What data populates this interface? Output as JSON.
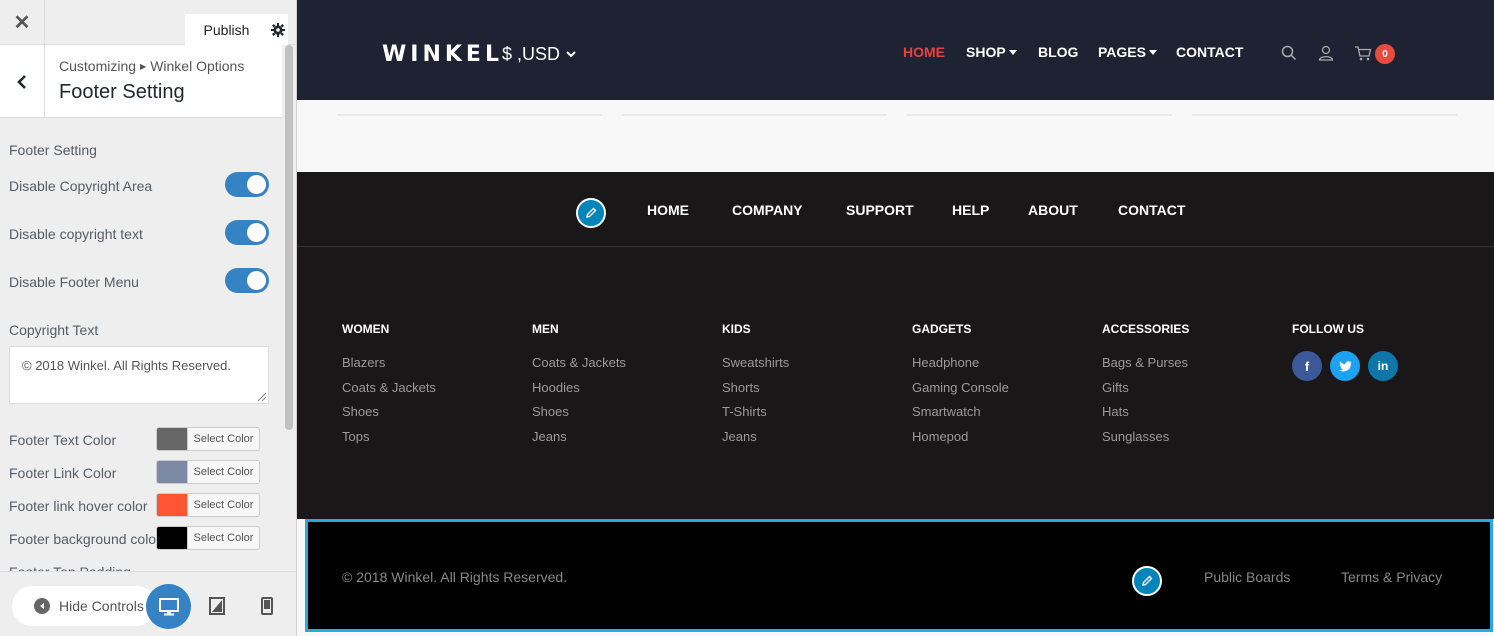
{
  "customizer": {
    "close_icon": "close-icon",
    "publish_label": "Publish",
    "breadcrumb_root": "Customizing",
    "breadcrumb_current": "Winkel Options",
    "section_title": "Footer Setting",
    "group_label": "Footer Setting",
    "toggles": [
      {
        "label": "Disable Copyright Area",
        "on": true
      },
      {
        "label": "Disable copyright text",
        "on": true
      },
      {
        "label": "Disable Footer Menu",
        "on": true
      }
    ],
    "copyright_label": "Copyright Text",
    "copyright_value": "© 2018 Winkel. All Rights Reserved.",
    "colors": [
      {
        "label": "Footer Text Color",
        "swatch": "#666666",
        "button": "Select Color"
      },
      {
        "label": "Footer Link Color",
        "swatch": "#7d8aa6",
        "button": "Select Color"
      },
      {
        "label": "Footer link hover color",
        "swatch": "#ff5533",
        "button": "Select Color"
      },
      {
        "label": "Footer background color",
        "swatch": "#000000",
        "button": "Select Color"
      }
    ],
    "next_field_label": "Footer Top Padding",
    "hide_controls_label": "Hide Controls",
    "accent_color": "#3582c4"
  },
  "site": {
    "logo": "WINKEL",
    "currency": "$ ,USD",
    "nav": [
      {
        "label": "HOME",
        "active": true
      },
      {
        "label": "SHOP",
        "dropdown": true
      },
      {
        "label": "BLOG"
      },
      {
        "label": "PAGES",
        "dropdown": true
      },
      {
        "label": "CONTACT"
      }
    ],
    "cart_count": "0",
    "nav_active_color": "#e8423d",
    "header_bg": "#1f2233"
  },
  "footer_menu": [
    "HOME",
    "COMPANY",
    "SUPPORT",
    "HELP",
    "ABOUT",
    "CONTACT"
  ],
  "footer_columns": [
    {
      "title": "WOMEN",
      "links": [
        "Blazers",
        "Coats & Jackets",
        "Shoes",
        "Tops"
      ]
    },
    {
      "title": "MEN",
      "links": [
        "Coats & Jackets",
        "Hoodies",
        "Shoes",
        "Jeans"
      ]
    },
    {
      "title": "KIDS",
      "links": [
        "Sweatshirts",
        "Shorts",
        "T-Shirts",
        "Jeans"
      ]
    },
    {
      "title": "GADGETS",
      "links": [
        "Headphone",
        "Gaming Console",
        "Smartwatch",
        "Homepod"
      ]
    },
    {
      "title": "ACCESSORIES",
      "links": [
        "Bags & Purses",
        "Gifts",
        "Hats",
        "Sunglasses"
      ]
    }
  ],
  "follow_us": {
    "title": "FOLLOW US",
    "networks": [
      {
        "icon": "facebook-icon",
        "color": "#3b5998"
      },
      {
        "icon": "twitter-icon",
        "color": "#1da1f2"
      },
      {
        "icon": "linkedin-icon",
        "color": "#0e76a8"
      }
    ]
  },
  "copyright_bar": {
    "text": "© 2018 Winkel. All Rights Reserved.",
    "links": [
      "Public Boards",
      "Terms & Privacy"
    ],
    "highlight_color": "#29a9e1"
  }
}
